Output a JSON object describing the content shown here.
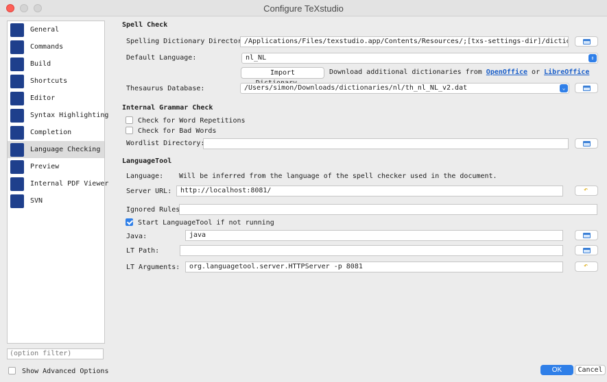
{
  "window": {
    "title": "Configure TeXstudio"
  },
  "sidebar": {
    "items": [
      {
        "label": "General",
        "icon": "txs-general-icon",
        "color": "#1a3c8a"
      },
      {
        "label": "Commands",
        "icon": "commands-icon",
        "color": "#1a3c8a"
      },
      {
        "label": "Build",
        "icon": "build-icon",
        "color": "#1a3c8a"
      },
      {
        "label": "Shortcuts",
        "icon": "shortcuts-icon",
        "color": "#1a3c8a"
      },
      {
        "label": "Editor",
        "icon": "editor-icon",
        "color": "#1a3c8a"
      },
      {
        "label": "Syntax Highlighting",
        "icon": "syntax-highlighting-icon",
        "color": "#1a3c8a"
      },
      {
        "label": "Completion",
        "icon": "completion-icon",
        "color": "#1a3c8a"
      },
      {
        "label": "Language Checking",
        "icon": "language-checking-icon",
        "color": "#1a3c8a"
      },
      {
        "label": "Preview",
        "icon": "preview-icon",
        "color": "#1a3c8a"
      },
      {
        "label": "Internal PDF Viewer",
        "icon": "pdf-viewer-icon",
        "color": "#1a3c8a"
      },
      {
        "label": "SVN",
        "icon": "svn-icon",
        "color": "#1a3c8a"
      }
    ],
    "selected": "Language Checking",
    "filter_placeholder": "(option filter)",
    "advanced_label": "Show Advanced Options"
  },
  "spell": {
    "title": "Spell Check",
    "dict_dirs_label": "Spelling Dictionary Directories:",
    "dict_dirs_value": "/Applications/Files/texstudio.app/Contents/Resources/;[txs-settings-dir]/dictionaries",
    "default_lang_label": "Default Language:",
    "default_lang_value": "nl_NL",
    "import_label": "Import Dictionary...",
    "download_text": "Download additional dictionaries from",
    "link_openoffice": "OpenOffice",
    "or_text": "or",
    "link_libreoffice": "LibreOffice",
    "thesaurus_label": "Thesaurus Database:",
    "thesaurus_value": "/Users/simon/Downloads/dictionaries/nl/th_nl_NL_v2.dat"
  },
  "grammar": {
    "title": "Internal Grammar Check",
    "word_rep_label": "Check for Word Repetitions",
    "bad_words_label": "Check for Bad Words",
    "wordlist_label": "Wordlist Directory:",
    "wordlist_value": ""
  },
  "lt": {
    "title": "LanguageTool",
    "language_label": "Language:",
    "language_text": "Will be inferred from the language of the spell checker used in the document.",
    "server_label": "Server URL:",
    "server_value": "http://localhost:8081/",
    "ignored_label": "Ignored Rules:",
    "ignored_value": "",
    "start_label": "Start LanguageTool if not running",
    "start_checked": true,
    "java_label": "Java:",
    "java_value": "java",
    "path_label": "LT Path:",
    "path_value": "",
    "args_label": "LT Arguments:",
    "args_value": "org.languagetool.server.HTTPServer -p 8081"
  },
  "footer": {
    "ok_label": "OK",
    "cancel_label": "Cancel"
  },
  "colors": {
    "accent": "#2f7fe8",
    "link": "#1b5fc9"
  }
}
